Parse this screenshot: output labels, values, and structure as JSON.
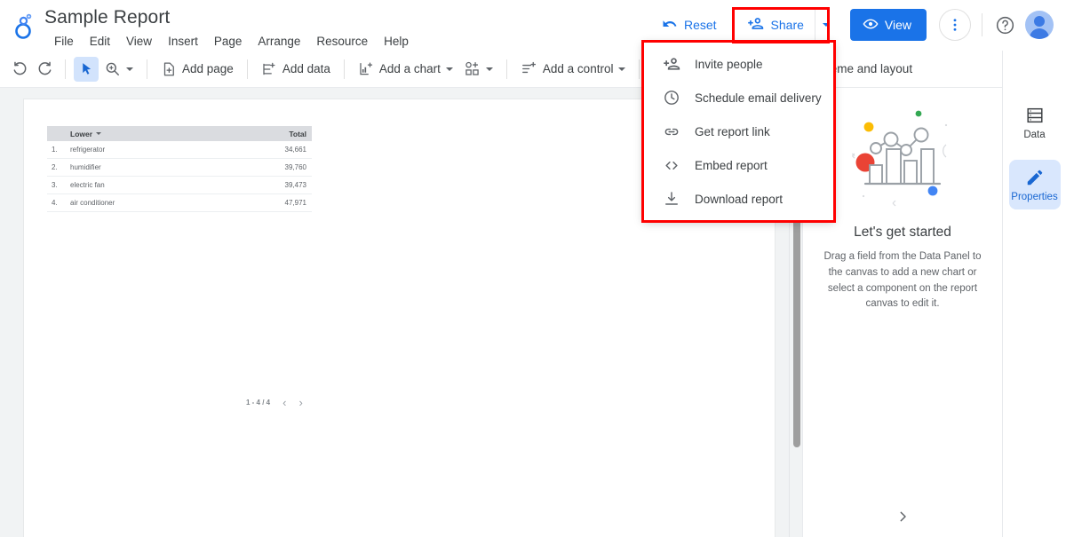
{
  "app": {
    "logo_icon": "looker-studio-logo",
    "doc_title": "Sample Report"
  },
  "menubar": {
    "items": [
      {
        "label": "File"
      },
      {
        "label": "Edit"
      },
      {
        "label": "View"
      },
      {
        "label": "Insert"
      },
      {
        "label": "Page"
      },
      {
        "label": "Arrange"
      },
      {
        "label": "Resource"
      },
      {
        "label": "Help"
      }
    ]
  },
  "header_actions": {
    "reset_label": "Reset",
    "reset_icon": "undo-arrow-icon",
    "share_label": "Share",
    "share_icon": "person-add-icon",
    "share_caret_icon": "chevron-down-icon",
    "view_label": "View",
    "view_icon": "eye-icon",
    "more_icon": "more-vert-icon",
    "help_icon": "help-circle-icon",
    "avatar_icon": "user-avatar"
  },
  "toolbar": {
    "undo_icon": "undo-icon",
    "redo_icon": "redo-icon",
    "select_icon": "cursor-arrow-icon",
    "zoom_icon": "magnifier-icon",
    "items": [
      {
        "label": "Add page",
        "icon": "add-page-icon",
        "caret": false
      },
      {
        "label": "Add data",
        "icon": "add-data-icon",
        "caret": false
      },
      {
        "label": "Add a chart",
        "icon": "add-chart-icon",
        "caret": true
      },
      {
        "label": "",
        "icon": "add-shape-icon",
        "caret": true
      },
      {
        "label": "Add a control",
        "icon": "add-control-icon",
        "caret": true
      },
      {
        "label": "",
        "icon": "embed-code-icon",
        "caret": false
      }
    ]
  },
  "share_menu": {
    "items": [
      {
        "label": "Invite people",
        "icon": "person-add-icon"
      },
      {
        "label": "Schedule email delivery",
        "icon": "clock-icon"
      },
      {
        "label": "Get report link",
        "icon": "link-icon"
      },
      {
        "label": "Embed report",
        "icon": "embed-code-icon"
      },
      {
        "label": "Download report",
        "icon": "download-icon"
      }
    ]
  },
  "report_table": {
    "headers": {
      "index": "",
      "dimension": "Lower",
      "metric": "Total"
    },
    "sort_caret_icon": "sort-descending-caret-icon",
    "rows": [
      {
        "index": "1.",
        "dimension": "refrigerator",
        "total": "34,661"
      },
      {
        "index": "2.",
        "dimension": "humidifier",
        "total": "39,760"
      },
      {
        "index": "3.",
        "dimension": "electric fan",
        "total": "39,473"
      },
      {
        "index": "4.",
        "dimension": "air conditioner",
        "total": "47,971"
      }
    ],
    "pager": {
      "range": "1 - 4 / 4",
      "prev_icon": "chevron-left-icon",
      "next_icon": "chevron-right-icon"
    }
  },
  "right_panel": {
    "header_title": "Theme and layout",
    "illustration_icon": "chart-illustration",
    "empty_title": "Let's get started",
    "empty_description": "Drag a field from the Data Panel to the canvas to add a new chart or select a component on the report canvas to edit it.",
    "expand_icon": "chevron-right-icon"
  },
  "rail": {
    "items": [
      {
        "label": "Data",
        "icon": "data-table-icon",
        "active": false
      },
      {
        "label": "Properties",
        "icon": "pencil-icon",
        "active": true
      }
    ]
  },
  "colors": {
    "accent_blue": "#1a73e8",
    "highlight_red": "#ff0000",
    "active_chip": "#d2e3fc",
    "canvas_bg": "#f1f3f4"
  }
}
